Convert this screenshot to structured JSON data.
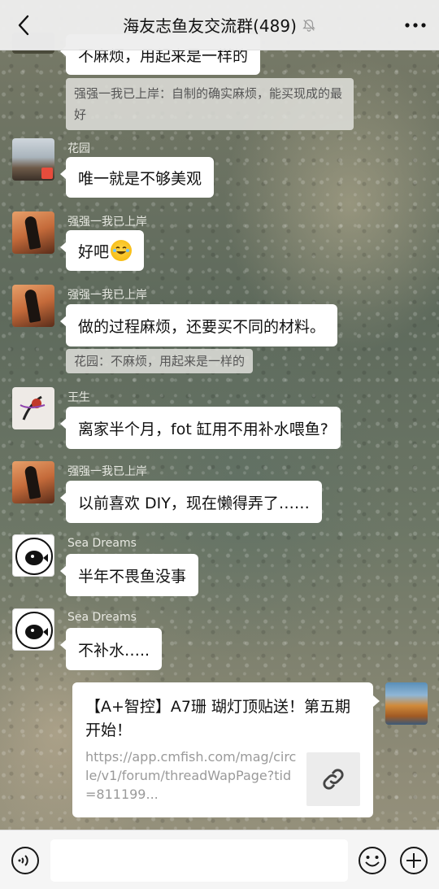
{
  "header": {
    "title": "海友志鱼友交流群(489)",
    "back_icon": "back-chevron-icon",
    "mute_icon": "bell-muted-icon",
    "more_icon": "more-dots-icon"
  },
  "messages": [
    {
      "bubble_text": "不麻烦，用起来是一样的",
      "quote_text": "强强一我已上岸：自制的确实麻烦，能买现成的最好"
    },
    {
      "sender": "花园",
      "bubble_text": "唯一就是不够美观"
    },
    {
      "sender": "强强一我已上岸",
      "bubble_text": "好吧"
    },
    {
      "sender": "强强一我已上岸",
      "bubble_text": "做的过程麻烦，还要买不同的材料。",
      "quote_text": "花园：不麻烦，用起来是一样的"
    },
    {
      "sender": "王生",
      "bubble_text": "离家半个月，fot 缸用不用补水喂鱼?"
    },
    {
      "sender": "强强一我已上岸",
      "bubble_text": "以前喜欢 DIY，现在懒得弄了……"
    },
    {
      "sender": "Sea Dreams",
      "bubble_text": "半年不畏鱼没事"
    },
    {
      "sender": "Sea Dreams",
      "bubble_text": "不补水….."
    }
  ],
  "link_card": {
    "title": "【A+智控】A7珊 瑚灯顶贴送！第五期开始！",
    "url": "https://app.cmfish.com/mag/circle/v1/forum/threadWapPage?tid=811199...",
    "thumb_icon": "link-icon"
  },
  "input_bar": {
    "voice_icon": "voice-icon",
    "emoji_icon": "emoji-icon",
    "plus_icon": "plus-icon"
  }
}
